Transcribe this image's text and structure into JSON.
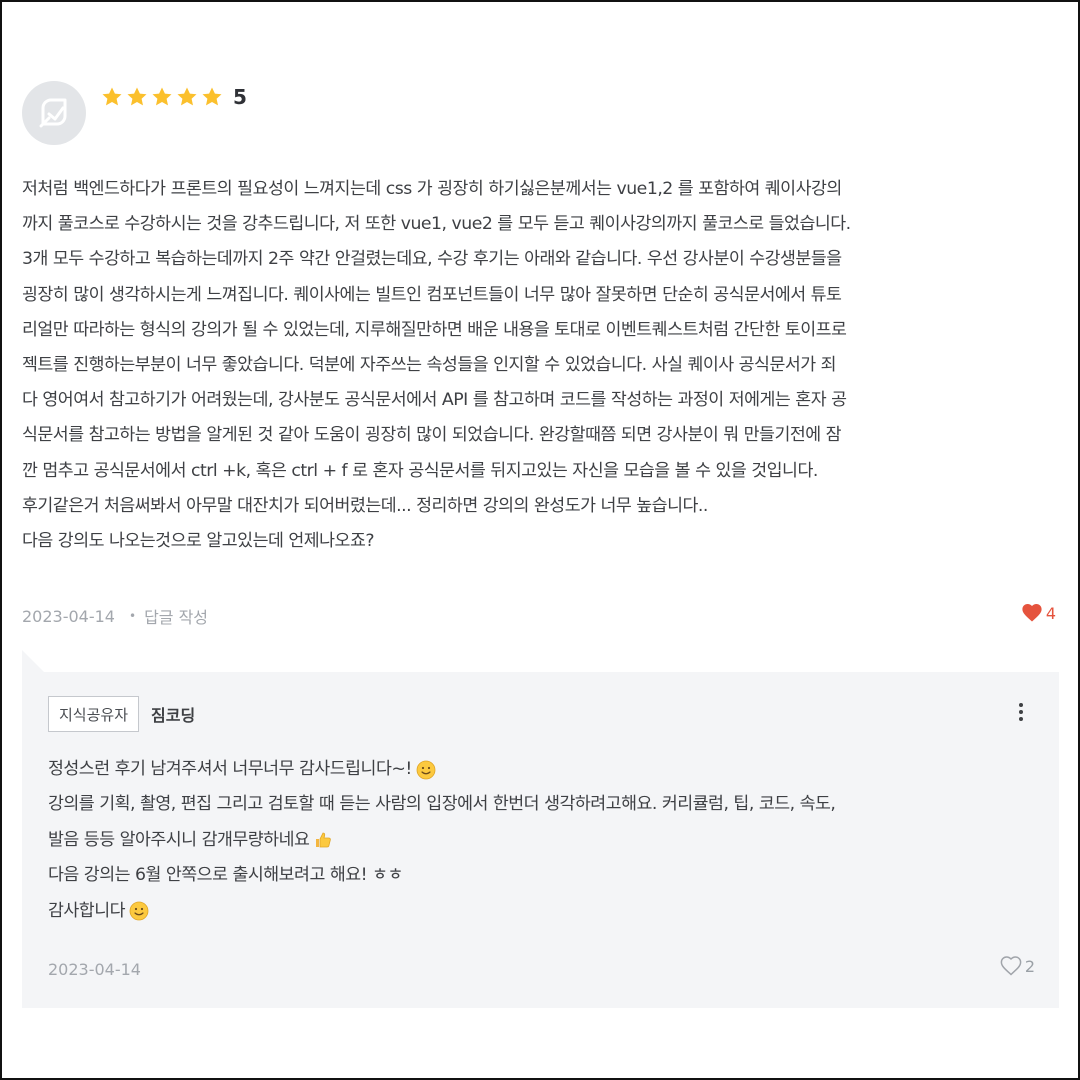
{
  "review": {
    "avatar_icon": "default-avatar-icon",
    "rating": {
      "stars": 5,
      "max": 5,
      "value_label": "5",
      "star_color": "#fbc02d"
    },
    "body_lines": [
      "저처럼 백엔드하다가 프론트의 필요성이 느껴지는데 css 가 굉장히 하기싫은분께서는 vue1,2 를 포함하여 퀘이사강의",
      "까지 풀코스로 수강하시는 것을 강추드립니다, 저 또한 vue1, vue2 를 모두 듣고 퀘이사강의까지 풀코스로 들었습니다.",
      "3개 모두 수강하고 복습하는데까지 2주 약간 안걸렸는데요, 수강 후기는 아래와 같습니다. 우선 강사분이 수강생분들을",
      "굉장히 많이 생각하시는게 느껴집니다. 퀘이사에는 빌트인 컴포넌트들이 너무 많아 잘못하면 단순히 공식문서에서 튜토",
      "리얼만 따라하는 형식의 강의가 될 수 있었는데, 지루해질만하면 배운 내용을 토대로 이벤트퀘스트처럼 간단한 토이프로",
      "젝트를 진행하는부분이 너무 좋았습니다. 덕분에 자주쓰는 속성들을 인지할 수 있었습니다. 사실 퀘이사 공식문서가 죄",
      "다 영어여서 참고하기가 어려웠는데, 강사분도 공식문서에서 API 를 참고하며 코드를 작성하는 과정이 저에게는 혼자 공",
      "식문서를 참고하는 방법을 알게된 것 같아 도움이 굉장히 많이 되었습니다. 완강할때쯤 되면 강사분이 뭐 만들기전에 잠",
      "깐 멈추고 공식문서에서 ctrl +k, 혹은 ctrl + f 로 혼자 공식문서를 뒤지고있는 자신을 모습을 볼 수 있을 것입니다.",
      "후기같은거 처음써봐서 아무말 대잔치가 되어버렸는데... 정리하면 강의의 완성도가 너무 높습니다..",
      "다음 강의도 나오는것으로 알고있는데 언제나오죠?"
    ],
    "date": "2023-04-14",
    "separator": "•",
    "reply_link_label": "답글 작성",
    "likes": {
      "count": "4",
      "liked": true,
      "icon": "heart-filled-icon",
      "color": "#e5533d"
    }
  },
  "reply": {
    "badge_label": "지식공유자",
    "author": "짐코딩",
    "more_icon": "more-vertical-icon",
    "lines": [
      {
        "text": "정성스런 후기 남겨주셔서 너무너무 감사드립니다~!",
        "emoji": "smiling-face-icon"
      },
      {
        "text": "강의를 기획, 촬영, 편집 그리고 검토할 때 듣는 사람의 입장에서 한번더 생각하려고해요. 커리큘럼, 팁, 코드, 속도,",
        "emoji": null
      },
      {
        "text": "발음 등등 알아주시니 감개무량하네요",
        "emoji": "thumbs-up-icon"
      },
      {
        "text": "다음 강의는 6월 안쪽으로 출시해보려고 해요! ㅎㅎ",
        "emoji": null
      },
      {
        "text": "감사합니다",
        "emoji": "smiling-face-icon"
      }
    ],
    "date": "2023-04-14",
    "likes": {
      "count": "2",
      "liked": false,
      "icon": "heart-outline-icon"
    }
  }
}
